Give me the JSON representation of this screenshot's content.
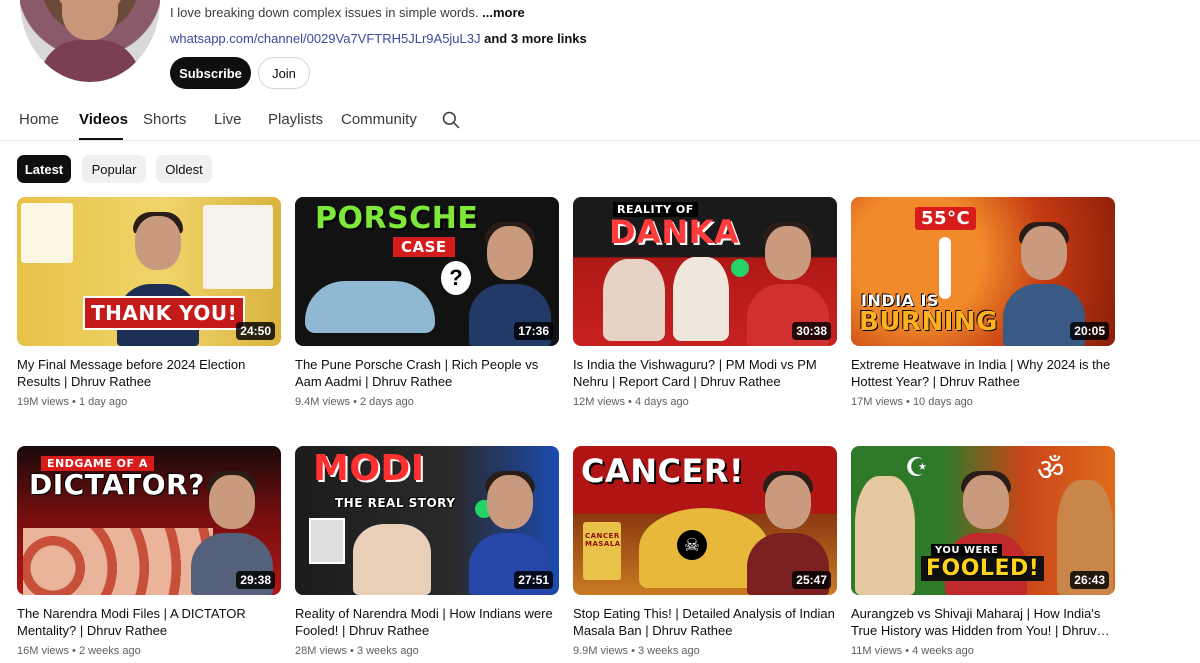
{
  "channel": {
    "description": "I love breaking down complex issues in simple words.",
    "more_label": "...more",
    "link": "whatsapp.com/channel/0029Va7VFTRH5JLr9A5juL3J",
    "more_links": "and 3 more links",
    "subscribe_label": "Subscribe",
    "join_label": "Join"
  },
  "tabs": [
    {
      "label": "Home"
    },
    {
      "label": "Videos"
    },
    {
      "label": "Shorts"
    },
    {
      "label": "Live"
    },
    {
      "label": "Playlists"
    },
    {
      "label": "Community"
    }
  ],
  "active_tab": "Videos",
  "search_icon": "search-icon",
  "chips": [
    {
      "label": "Latest"
    },
    {
      "label": "Popular"
    },
    {
      "label": "Oldest"
    }
  ],
  "active_chip": "Latest",
  "videos": [
    {
      "thumb_text": "THANK YOU!",
      "thumb_bg": "#e8c24a",
      "duration": "24:50",
      "title": "My Final Message before 2024 Election Results | Dhruv Rathee",
      "views": "19M views",
      "age": "1 day ago"
    },
    {
      "thumb_text": "PORSCHE",
      "thumb_sub": "CASE",
      "thumb_bg": "#121212",
      "duration": "17:36",
      "title": "The Pune Porsche Crash | Rich People vs Aam Aadmi | Dhruv Rathee",
      "views": "9.4M views",
      "age": "2 days ago"
    },
    {
      "thumb_sub": "REALITY OF",
      "thumb_text": "DANKA",
      "thumb_bg": "#b01818",
      "duration": "30:38",
      "title": "Is India the Vishwaguru? | PM Modi vs PM Nehru | Report Card | Dhruv Rathee",
      "views": "12M views",
      "age": "4 days ago"
    },
    {
      "thumb_sub": "55°C",
      "thumb_text": "INDIA IS",
      "thumb_text2": "BURNING",
      "thumb_bg": "#c43a12",
      "duration": "20:05",
      "title": "Extreme Heatwave in India | Why 2024 is the Hottest Year? | Dhruv Rathee",
      "views": "17M views",
      "age": "10 days ago"
    },
    {
      "thumb_sub": "ENDGAME OF A",
      "thumb_text": "DICTATOR?",
      "thumb_bg": "#8c1010",
      "duration": "29:38",
      "title": "The Narendra Modi Files | A DICTATOR Mentality? | Dhruv Rathee",
      "views": "16M views",
      "age": "2 weeks ago"
    },
    {
      "thumb_text": "MODI",
      "thumb_sub": "THE REAL STORY",
      "thumb_bg": "#1c1c1c",
      "duration": "27:51",
      "title": "Reality of Narendra Modi | How Indians were Fooled! | Dhruv Rathee",
      "views": "28M views",
      "age": "3 weeks ago"
    },
    {
      "thumb_text": "CANCER!",
      "thumb_sub": "CANCER MASALA",
      "thumb_bg": "#b01414",
      "duration": "25:47",
      "title": "Stop Eating This! | Detailed Analysis of Indian Masala Ban | Dhruv Rathee",
      "views": "9.9M views",
      "age": "3 weeks ago"
    },
    {
      "thumb_sub": "YOU WERE",
      "thumb_text": "FOOLED!",
      "thumb_bg": "#2f7a2a",
      "duration": "26:43",
      "title": "Aurangzeb vs Shivaji Maharaj | How India's True History was Hidden from You! | Dhruv…",
      "views": "11M views",
      "age": "4 weeks ago"
    }
  ]
}
